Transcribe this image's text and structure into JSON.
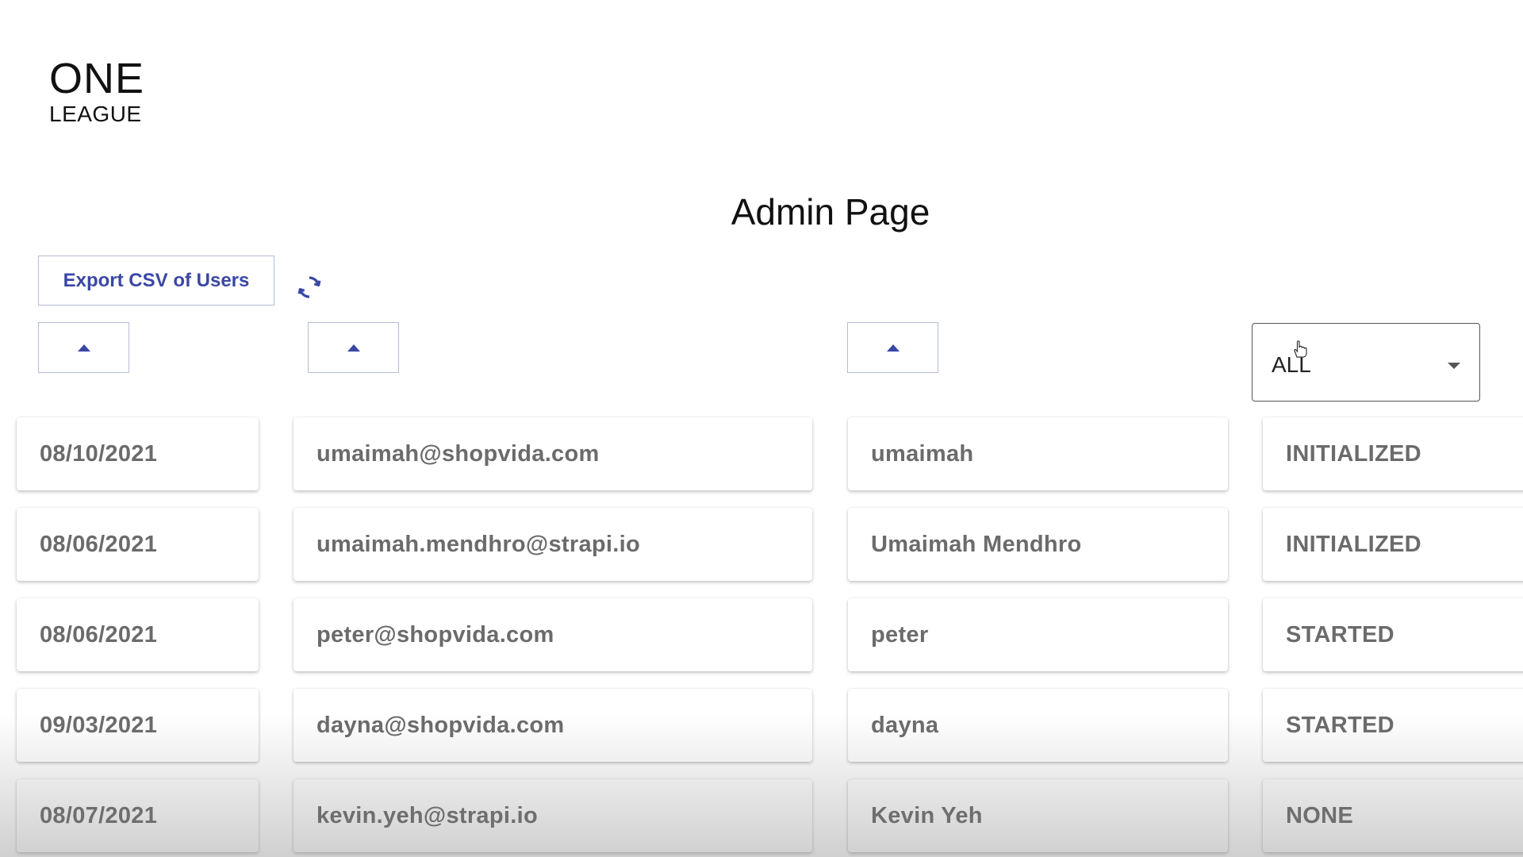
{
  "logo": {
    "line1": "ONE",
    "line2": "LEAGUE"
  },
  "page_title": "Admin Page",
  "toolbar": {
    "export_label": "Export CSV of Users"
  },
  "filter": {
    "status_value": "ALL"
  },
  "icons": {
    "refresh": "refresh-icon",
    "sort": "sort-ascending-icon",
    "dropdown": "chevron-down-icon",
    "cursor": "hand-pointer-icon"
  },
  "colors": {
    "accent": "#3a47a5",
    "text_muted": "#6b6b6b"
  },
  "users": [
    {
      "date": "08/10/2021",
      "email": "umaimah@shopvida.com",
      "name": "umaimah",
      "status": "INITIALIZED"
    },
    {
      "date": "08/06/2021",
      "email": "umaimah.mendhro@strapi.io",
      "name": "Umaimah Mendhro",
      "status": "INITIALIZED"
    },
    {
      "date": "08/06/2021",
      "email": "peter@shopvida.com",
      "name": "peter",
      "status": "STARTED"
    },
    {
      "date": "09/03/2021",
      "email": "dayna@shopvida.com",
      "name": "dayna",
      "status": "STARTED"
    },
    {
      "date": "08/07/2021",
      "email": "kevin.yeh@strapi.io",
      "name": "Kevin Yeh",
      "status": "NONE"
    }
  ]
}
